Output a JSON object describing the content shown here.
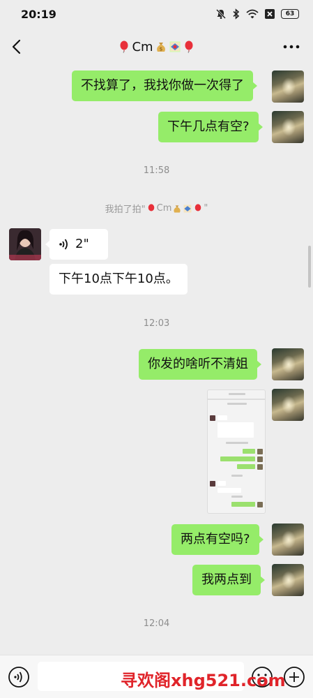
{
  "status_bar": {
    "time": "20:19",
    "battery": "63",
    "icons": [
      "mute-icon",
      "bluetooth-icon",
      "wifi-icon",
      "sim-off-icon",
      "battery-icon"
    ]
  },
  "header": {
    "title_text": "Cm",
    "title_emojis": [
      "balloon",
      "money-bag",
      "gift",
      "balloon"
    ],
    "back_icon": "chevron-left-icon",
    "more_icon": "ellipsis-icon"
  },
  "messages": [
    {
      "side": "self",
      "type": "text",
      "text": "不找算了，我找你做一次得了"
    },
    {
      "side": "self",
      "type": "text",
      "text": "下午几点有空?"
    },
    {
      "type": "time",
      "text": "11:58"
    },
    {
      "type": "system",
      "text_prefix": "我拍了拍\"",
      "text_name": "Cm",
      "text_suffix": "\""
    },
    {
      "side": "other",
      "type": "voice",
      "text": "2\""
    },
    {
      "side": "other",
      "type": "text",
      "text": "下午10点下午10点。"
    },
    {
      "type": "time",
      "text": "12:03"
    },
    {
      "side": "self",
      "type": "text",
      "text": "你发的啥听不清姐"
    },
    {
      "side": "self",
      "type": "image",
      "text": ""
    },
    {
      "side": "self",
      "type": "text",
      "text": "两点有空吗?"
    },
    {
      "side": "self",
      "type": "text",
      "text": "我两点到"
    },
    {
      "type": "time",
      "text": "12:04"
    }
  ],
  "input_bar": {
    "placeholder": "",
    "watermark": "寻欢阁xhg521.com"
  },
  "colors": {
    "background": "#ededed",
    "self_bubble": "#95ec69",
    "other_bubble": "#ffffff",
    "watermark": "#e0242a"
  }
}
